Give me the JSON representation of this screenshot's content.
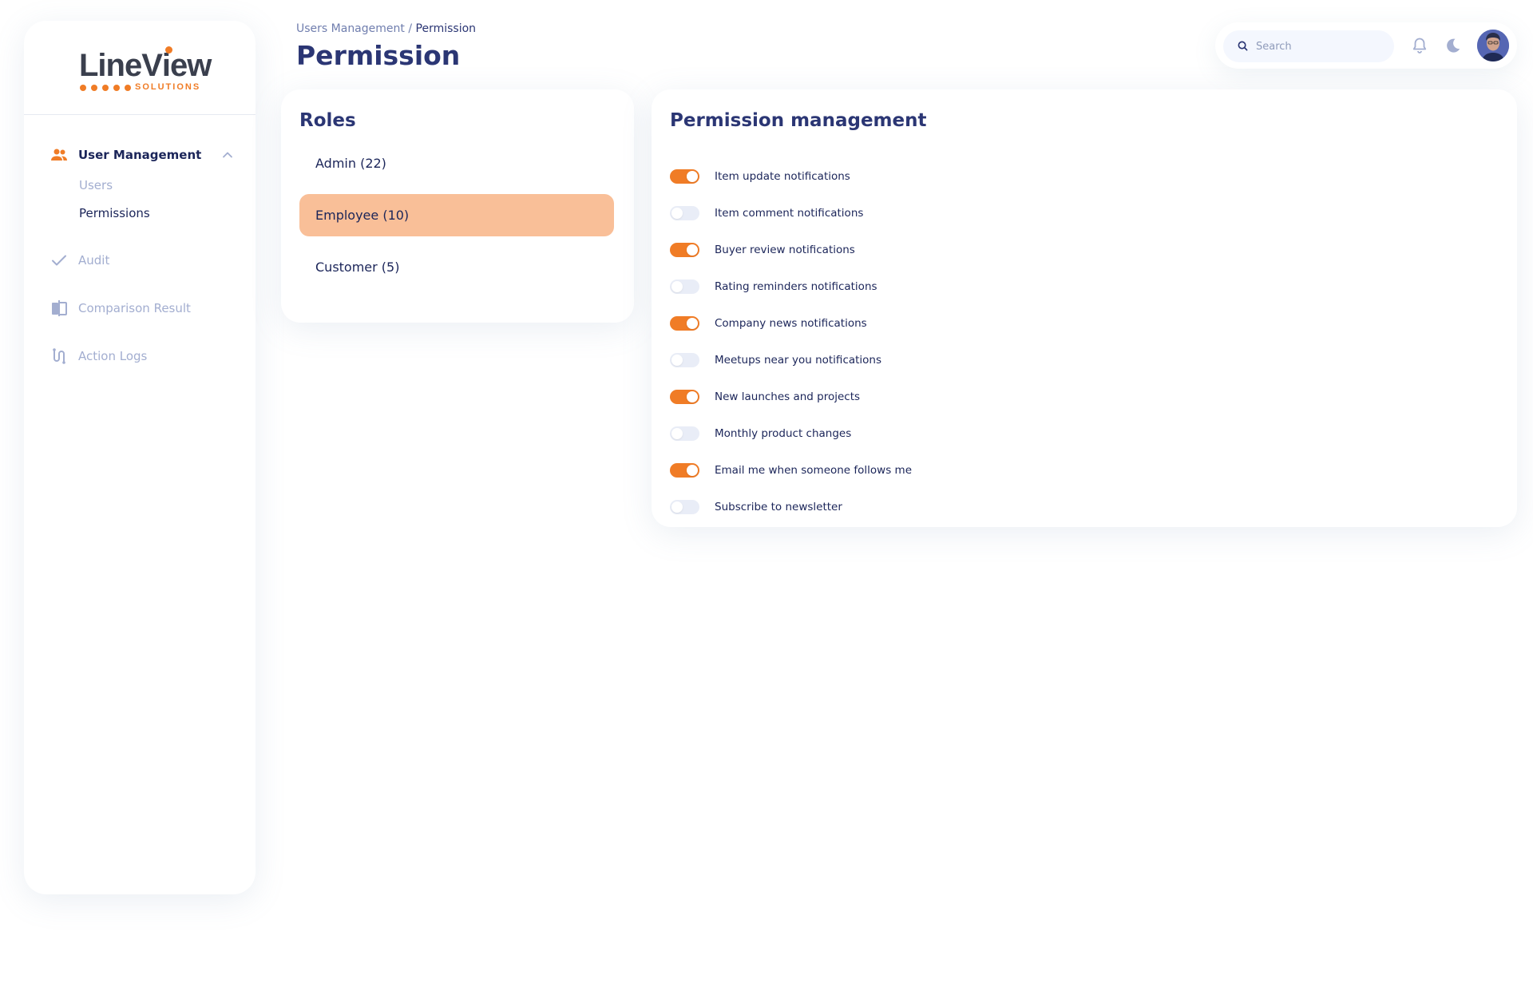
{
  "brand": {
    "name_part1": "LineV",
    "name_i": "i",
    "name_part2": "ew",
    "subtitle": "SOLUTIONS",
    "accent": "#f07c26"
  },
  "sidebar": {
    "sections": [
      {
        "label": "User Management",
        "icon": "users-icon",
        "active": true,
        "expanded": true,
        "children": [
          {
            "label": "Users",
            "active": false
          },
          {
            "label": "Permissions",
            "active": true
          }
        ]
      },
      {
        "label": "Audit",
        "icon": "check-icon"
      },
      {
        "label": "Comparison Result",
        "icon": "compare-icon"
      },
      {
        "label": "Action Logs",
        "icon": "route-icon"
      }
    ]
  },
  "header": {
    "breadcrumb_parent": "Users Management",
    "breadcrumb_sep": " / ",
    "breadcrumb_current": "Permission",
    "title": "Permission"
  },
  "topbar": {
    "search_placeholder": "Search",
    "icons": [
      "bell-icon",
      "moon-icon"
    ]
  },
  "roles": {
    "title": "Roles",
    "items": [
      {
        "label": "Admin (22)",
        "selected": false
      },
      {
        "label": "Employee (10)",
        "selected": true
      },
      {
        "label": "Customer (5)",
        "selected": false
      }
    ]
  },
  "permissions": {
    "title": "Permission management",
    "items": [
      {
        "label": "Item update notifications",
        "enabled": true
      },
      {
        "label": "Item comment notifications",
        "enabled": false
      },
      {
        "label": "Buyer review notifications",
        "enabled": true
      },
      {
        "label": "Rating reminders notifications",
        "enabled": false
      },
      {
        "label": "Company news notifications",
        "enabled": true
      },
      {
        "label": "Meetups near you notifications",
        "enabled": false
      },
      {
        "label": "New launches and projects",
        "enabled": true
      },
      {
        "label": "Monthly product changes",
        "enabled": false
      },
      {
        "label": "Email me when someone follows me",
        "enabled": true
      },
      {
        "label": "Subscribe to newsletter",
        "enabled": false
      }
    ]
  }
}
